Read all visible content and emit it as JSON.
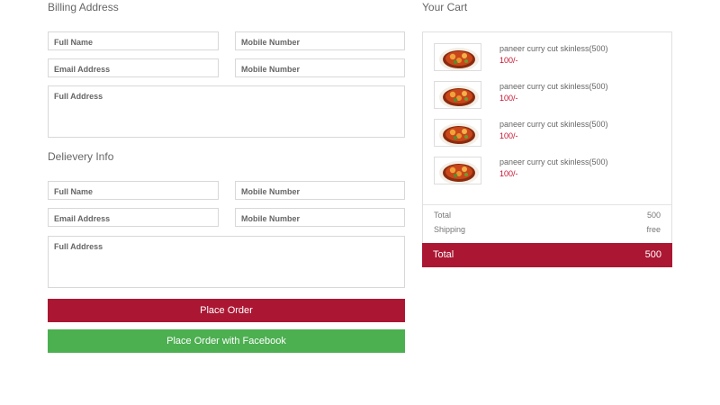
{
  "billing": {
    "title": "Billing Address",
    "full_name_placeholder": "Full Name",
    "mobile_placeholder_1": "Mobile Number",
    "email_placeholder": "Email Address",
    "mobile_placeholder_2": "Mobile Number",
    "address_placeholder": "Full Address"
  },
  "delivery": {
    "title": "Delievery Info",
    "full_name_placeholder": "Full Name",
    "mobile_placeholder_1": "Mobile Number",
    "email_placeholder": "Email Address",
    "mobile_placeholder_2": "Mobile Number",
    "address_placeholder": "Full Address"
  },
  "buttons": {
    "place_order": "Place Order",
    "place_order_fb": "Place Order with Facebook"
  },
  "colors": {
    "accent": "#ab1733",
    "facebook_button": "#4caf50",
    "price_text": "#c8102e"
  },
  "cart": {
    "title": "Your Cart",
    "items": [
      {
        "name": "paneer curry cut skinless(500)",
        "price": "100/-",
        "icon": "curry-dish-image"
      },
      {
        "name": "paneer curry cut skinless(500)",
        "price": "100/-",
        "icon": "curry-dish-image"
      },
      {
        "name": "paneer curry cut skinless(500)",
        "price": "100/-",
        "icon": "curry-dish-image"
      },
      {
        "name": "paneer curry cut skinless(500)",
        "price": "100/-",
        "icon": "curry-dish-image"
      }
    ],
    "subtotal_label": "Total",
    "subtotal_value": "500",
    "shipping_label": "Shipping",
    "shipping_value": "free",
    "total_label": "Total",
    "total_value": "500"
  }
}
